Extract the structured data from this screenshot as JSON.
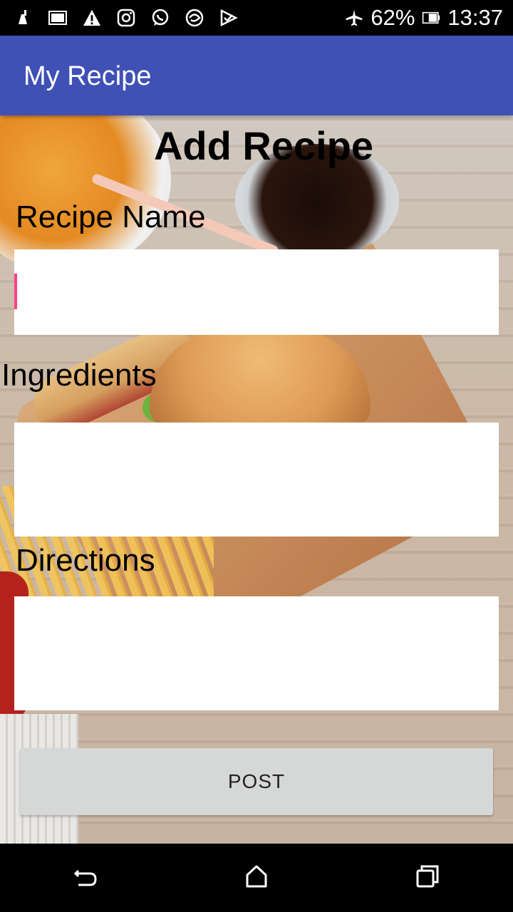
{
  "status_bar": {
    "icons": [
      "cleaner-icon",
      "gallery-icon",
      "warning-icon",
      "instagram-icon",
      "whatsapp-icon",
      "browser-icon",
      "check-icon"
    ],
    "battery_percent": "62%",
    "time": "13:37"
  },
  "app_bar": {
    "title": "My Recipe",
    "color": "#3F51B5"
  },
  "form": {
    "heading": "Add Recipe",
    "recipe_name_label": "Recipe Name",
    "recipe_name_value": "",
    "ingredients_label": "Ingredients",
    "ingredients_value": "",
    "directions_label": "Directions",
    "directions_value": "",
    "post_label": "POST"
  },
  "nav_bar": {
    "icons": [
      "back-icon",
      "home-icon",
      "recents-icon"
    ]
  },
  "colors": {
    "accent_cursor": "#FF4081",
    "button_bg": "#D6D7D7"
  }
}
